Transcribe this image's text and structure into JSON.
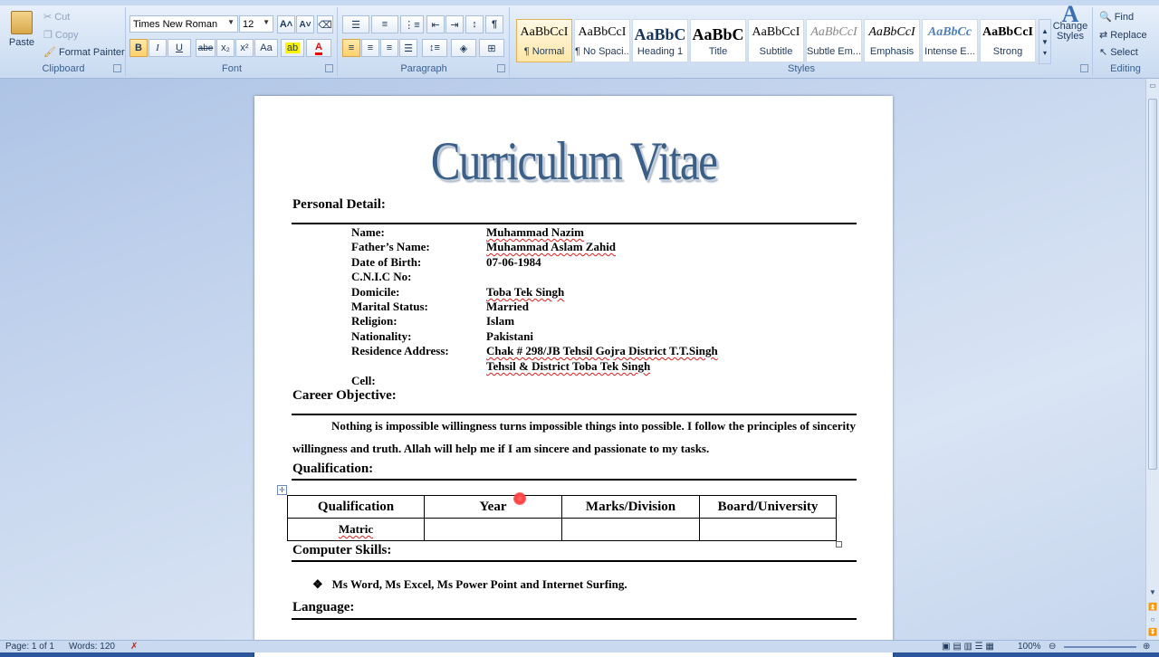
{
  "ribbon": {
    "clipboard": {
      "label": "Clipboard",
      "paste": "Paste",
      "cut": "Cut",
      "copy": "Copy",
      "format_painter": "Format Painter"
    },
    "font": {
      "label": "Font",
      "family": "Times New Roman",
      "size": "12",
      "bold": "B",
      "italic": "I",
      "underline": "U",
      "strike": "abe",
      "subscript": "x₂",
      "superscript": "x²",
      "change_case": "Aa",
      "grow": "A˄",
      "shrink": "A˅",
      "font_color": "A"
    },
    "paragraph": {
      "label": "Paragraph",
      "pilcrow": "¶"
    },
    "styles": {
      "label": "Styles",
      "items": [
        {
          "sample": "AaBbCcI",
          "name": "¶ Normal"
        },
        {
          "sample": "AaBbCcI",
          "name": "¶ No Spaci..."
        },
        {
          "sample": "AaBbC",
          "name": "Heading 1"
        },
        {
          "sample": "AaBbC",
          "name": "Title"
        },
        {
          "sample": "AaBbCcI",
          "name": "Subtitle"
        },
        {
          "sample": "AaBbCcI",
          "name": "Subtle Em..."
        },
        {
          "sample": "AaBbCcI",
          "name": "Emphasis"
        },
        {
          "sample": "AaBbCc",
          "name": "Intense E..."
        },
        {
          "sample": "AaBbCcI",
          "name": "Strong"
        }
      ],
      "change_styles": "Change Styles"
    },
    "editing": {
      "label": "Editing",
      "find": "Find",
      "replace": "Replace",
      "select": "Select"
    }
  },
  "document": {
    "title": "Curriculum Vitae",
    "personal_heading": "Personal Detail:",
    "personal": [
      {
        "label": "Name:",
        "value": "Muhammad Nazim"
      },
      {
        "label": "Father’s Name:",
        "value": "Muhammad Aslam Zahid"
      },
      {
        "label": "Date of Birth:",
        "value": "07-06-1984"
      },
      {
        "label": "C.N.I.C No:",
        "value": ""
      },
      {
        "label": "Domicile:",
        "value": "Toba Tek Singh"
      },
      {
        "label": "Marital Status:",
        "value": "Married"
      },
      {
        "label": "Religion:",
        "value": "Islam"
      },
      {
        "label": "Nationality:",
        "value": "Pakistani"
      },
      {
        "label": "Residence Address:",
        "value": "Chak # 298/JB Tehsil Gojra District T.T.Singh"
      },
      {
        "label": "",
        "value": "Tehsil & District Toba Tek Singh"
      },
      {
        "label": "Cell:",
        "value": ""
      }
    ],
    "career_heading": "Career Objective:",
    "career_text": "Nothing is impossible willingness turns impossible things into possible. I follow the principles of sincerity willingness and truth. Allah will help me if I am sincere and passionate to my tasks.",
    "qualification_heading": "Qualification:",
    "table": {
      "headers": [
        "Qualification",
        "Year",
        "Marks/Division",
        "Board/University"
      ],
      "rows": [
        [
          "Matric",
          "",
          "",
          ""
        ]
      ]
    },
    "skills_heading": "Computer Skills:",
    "skills": [
      "Ms Word, Ms Excel, Ms Power Point and Internet Surfing."
    ],
    "language_heading": "Language:"
  },
  "status": {
    "page": "Page: 1 of 1",
    "words": "Words: 120",
    "zoom": "100%"
  }
}
